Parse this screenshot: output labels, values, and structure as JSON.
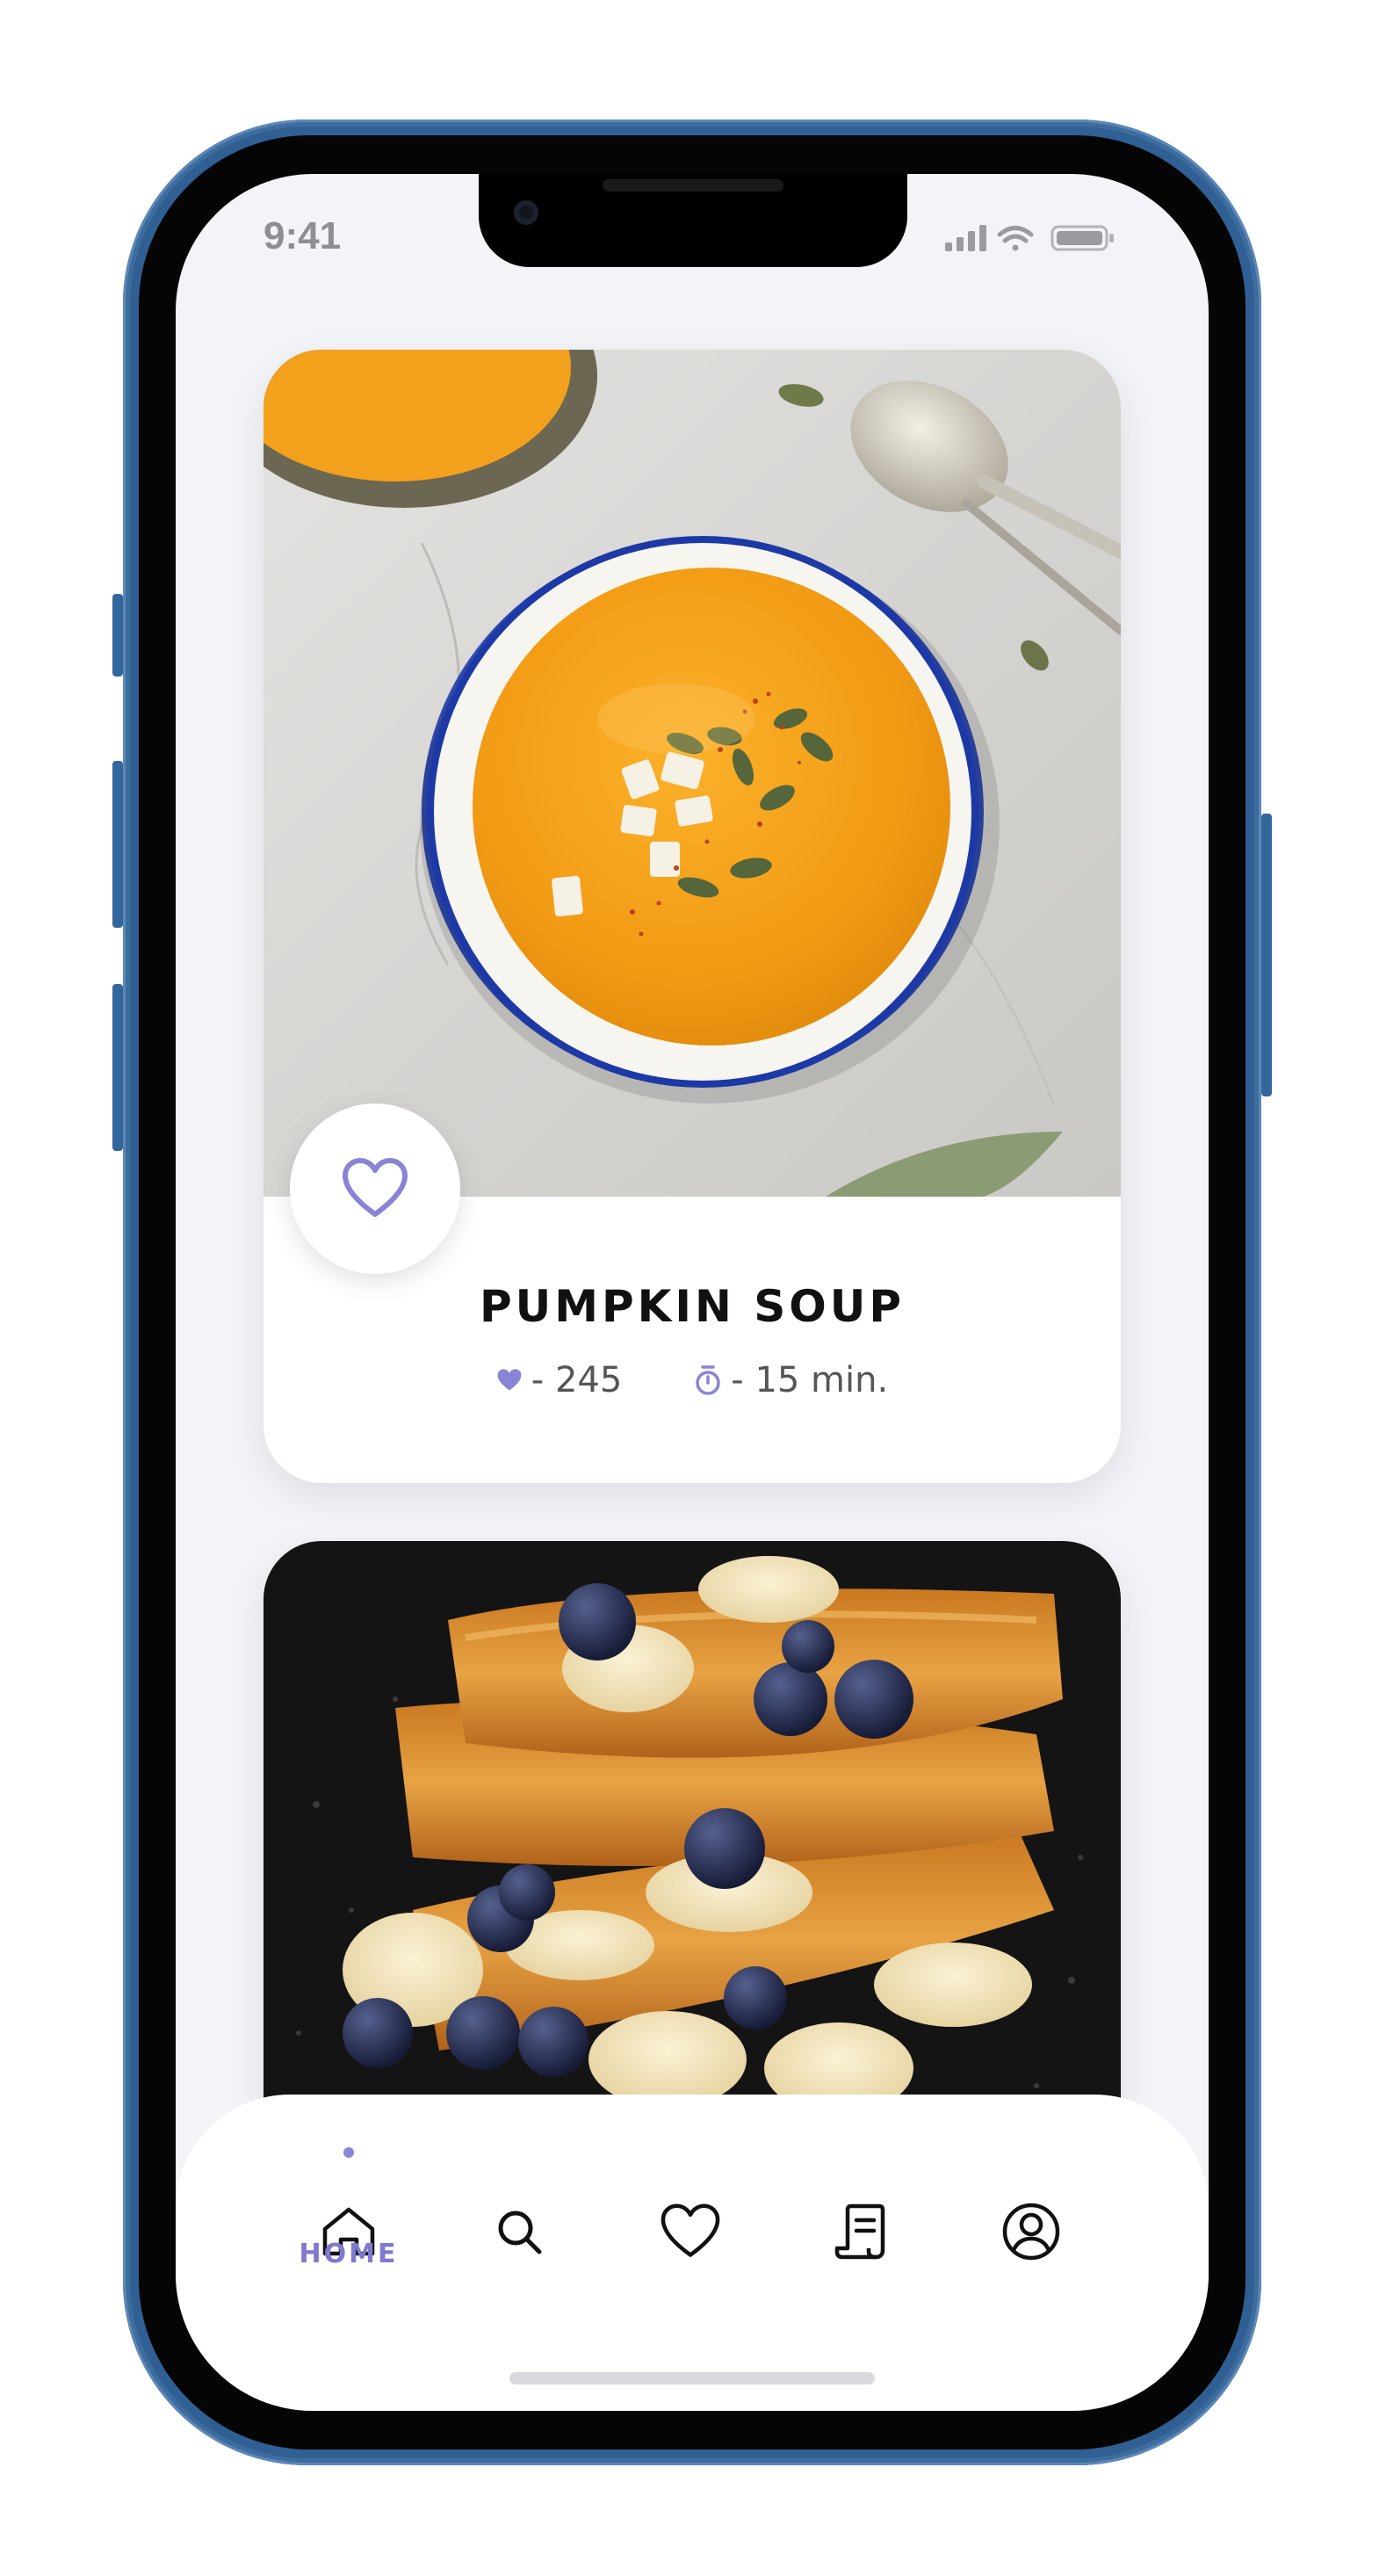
{
  "status_bar": {
    "time": "9:41"
  },
  "recipes": [
    {
      "title": "PUMPKIN SOUP",
      "likes": "- 245",
      "duration": "- 15 min."
    }
  ],
  "nav": {
    "items": [
      {
        "icon": "home-icon",
        "label": "HOME",
        "active": true
      },
      {
        "icon": "search-icon"
      },
      {
        "icon": "heart-icon"
      },
      {
        "icon": "recipe-scroll-icon"
      },
      {
        "icon": "profile-icon"
      }
    ]
  },
  "colors": {
    "accent": "#7f79cf",
    "screen_bg": "#f3f4f7",
    "frame": "#2f5f93"
  }
}
